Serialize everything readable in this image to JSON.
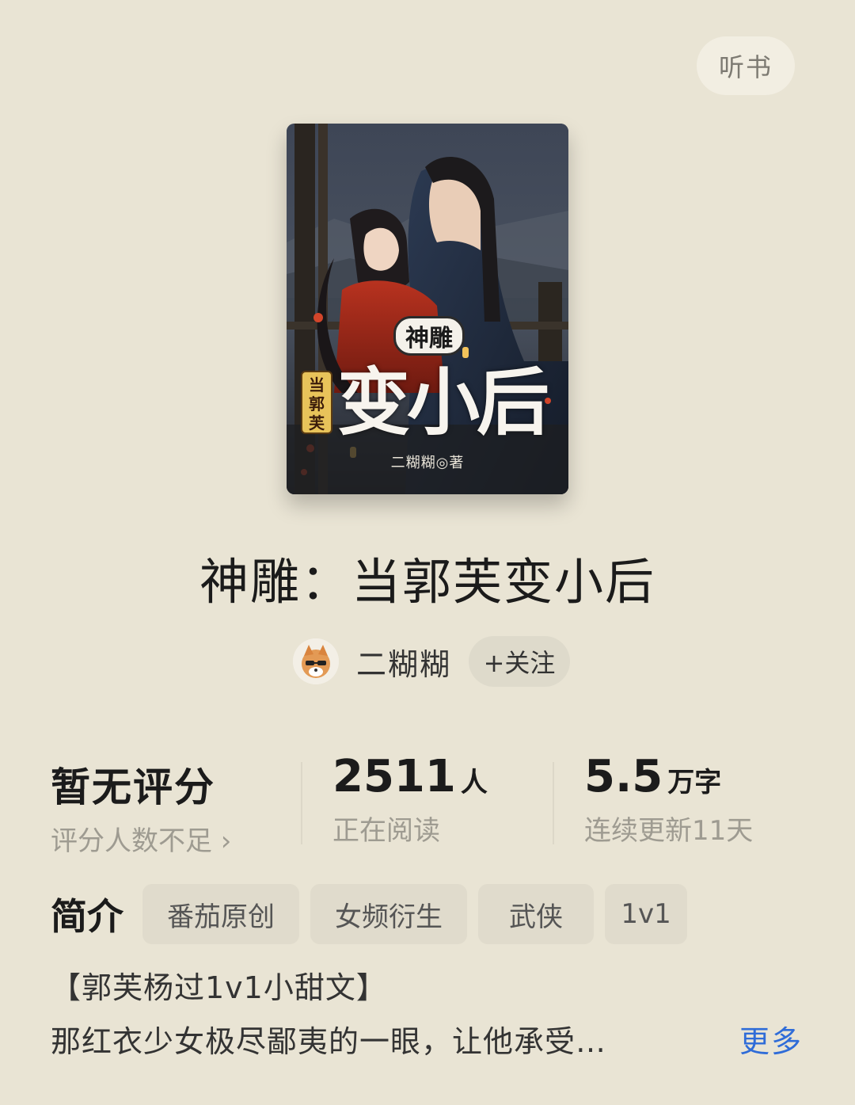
{
  "header": {
    "listen_label": "听书"
  },
  "cover": {
    "title_small": "神雕",
    "tag_text": "当郭芙",
    "title_big": "变小后",
    "author_line": "二糊糊◎著"
  },
  "book": {
    "title": "神雕：当郭芙变小后",
    "author": "二糊糊",
    "follow_label": "+关注"
  },
  "stats": {
    "rating": {
      "value": "暂无评分",
      "sub": "评分人数不足 ›"
    },
    "readers": {
      "value": "2511",
      "unit": "人",
      "sub": "正在阅读"
    },
    "words": {
      "value": "5.5",
      "unit": "万字",
      "sub": "连续更新11天"
    }
  },
  "intro": {
    "label": "简介",
    "tags": [
      "番茄原创",
      "女频衍生",
      "武侠",
      "1v1"
    ],
    "line1": "【郭芙杨过1v1小甜文】",
    "line2": "那红衣少女极尽鄙夷的一眼，让他承受…",
    "more_label": "更多"
  },
  "colors": {
    "background": "#e9e4d4",
    "accent_link": "#2f6cd8"
  }
}
